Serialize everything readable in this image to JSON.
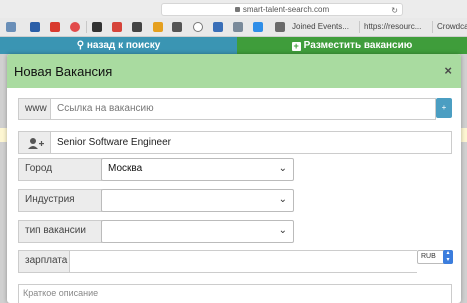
{
  "browser": {
    "url": "smart-talent-search.com",
    "bookmarks": [
      {
        "label": "Joined Events...",
        "color": "#5a5a5a"
      },
      {
        "label": "https://resourc...",
        "color": "#5a5a5a"
      },
      {
        "label": "Crowdcast",
        "color": "#5a5a5a"
      }
    ]
  },
  "navbar": {
    "back_label": "назад к поиску",
    "post_label": "Разместить вакансию"
  },
  "modal": {
    "title": "Новая Вакансия",
    "close_symbol": "×",
    "url_addon": "www",
    "url_placeholder": "Ссылка на вакансию",
    "url_add": "+",
    "position_value": "Senior Software Engineer",
    "city_label": "Город",
    "city_value": "Москва",
    "industry_label": "Индустрия",
    "industry_value": "",
    "type_label": "тип вакансии",
    "type_value": "",
    "salary_label": "зарплата",
    "salary_value": "",
    "currency": "RUB",
    "description_placeholder": "Краткое описание"
  },
  "colors": {
    "nav_left": "#3a95b3",
    "nav_right": "#3f9d3b",
    "modal_header": "#a9dba0"
  }
}
